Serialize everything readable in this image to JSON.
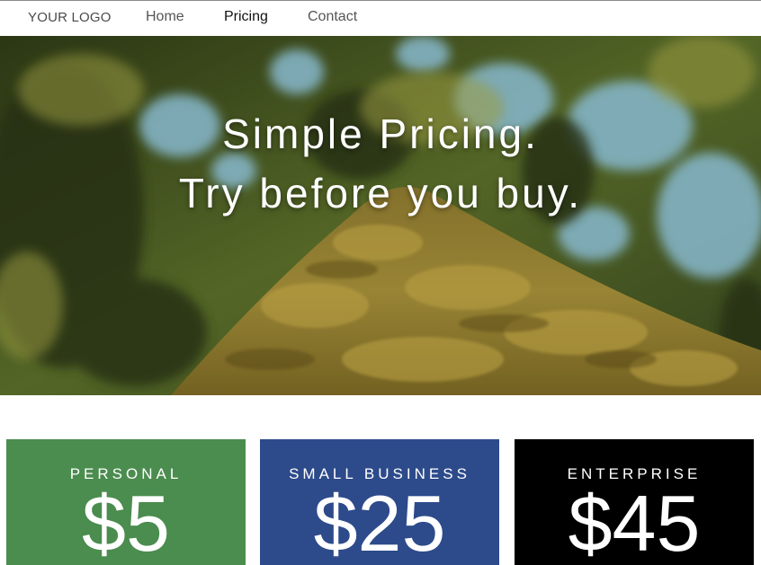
{
  "nav": {
    "logo": "YOUR LOGO",
    "links": [
      {
        "label": "Home",
        "active": false
      },
      {
        "label": "Pricing",
        "active": true
      },
      {
        "label": "Contact",
        "active": false
      }
    ]
  },
  "hero": {
    "line1": "Simple Pricing.",
    "line2": "Try before you buy."
  },
  "plans": [
    {
      "name": "PERSONAL",
      "price": "$5",
      "color": "#4b8c4f"
    },
    {
      "name": "SMALL BUSINESS",
      "price": "$25",
      "color": "#2d4b8b"
    },
    {
      "name": "ENTERPRISE",
      "price": "$45",
      "color": "#000000"
    }
  ]
}
